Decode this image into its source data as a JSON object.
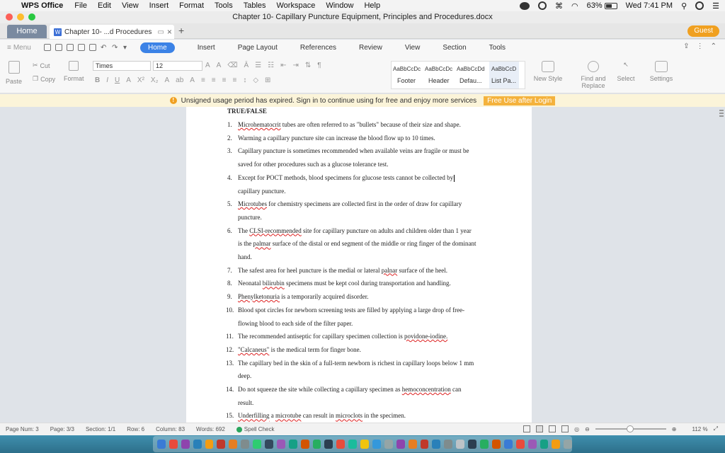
{
  "menubar": {
    "app_name": "WPS Office",
    "items": [
      "File",
      "Edit",
      "View",
      "Insert",
      "Format",
      "Tools",
      "Tables",
      "Workspace",
      "Window",
      "Help"
    ],
    "battery": "63%",
    "battery_level": 0.63,
    "clock": "Wed 7:41 PM"
  },
  "window": {
    "title": "Chapter 10- Capillary Puncture Equipment, Principles and Procedures.docx"
  },
  "tabs": {
    "home": "Home",
    "doc": "Chapter 10- ...d Procedures",
    "doc_close": "×",
    "new": "+",
    "guest": "Guest"
  },
  "ribbon_tabs": {
    "menu": "Menu",
    "items": [
      "Home",
      "Insert",
      "Page Layout",
      "References",
      "Review",
      "View",
      "Section",
      "Tools"
    ]
  },
  "ribbon": {
    "paste": "Paste",
    "cut": "Cut",
    "copy": "Copy",
    "format": "Format",
    "font_name": "Times",
    "font_size": "12",
    "styles_preview": [
      "AaBbCcDc",
      "AaBbCcDc",
      "AaBbCcDd",
      "AaBbCcD"
    ],
    "styles_names": [
      "Footer",
      "Header",
      "Defau...",
      "List Pa..."
    ],
    "new_style": "New Style",
    "find_replace": "Find and Replace",
    "select": "Select",
    "settings": "Settings"
  },
  "notice": {
    "text": "Unsigned usage period has expired. Sign in to continue using for free and enjoy more services",
    "button": "Free Use after Login"
  },
  "document": {
    "heading": "TRUE/FALSE",
    "lines": [
      {
        "num": "1.",
        "text": "Microhematocrit tubes are often referred to as \"bullets\" because of their size and shape."
      },
      {
        "num": "2.",
        "text": "Warming a capillary puncture site can increase the blood flow up to 10 times."
      },
      {
        "num": "3.",
        "text": "Capillary puncture is sometimes recommended when available veins are fragile or must be"
      },
      {
        "num": "",
        "text": "saved for other procedures such as a glucose tolerance test."
      },
      {
        "num": "4.",
        "text": "Except for POCT methods, blood specimens for glucose tests cannot be collected by"
      },
      {
        "num": "",
        "text": "capillary puncture."
      },
      {
        "num": "5.",
        "text": "Microtubes for chemistry specimens are collected first in the order of draw for capillary"
      },
      {
        "num": "",
        "text": "puncture."
      },
      {
        "num": "6.",
        "text": "The CLSI-recommended site for capillary puncture on adults and children older than 1 year"
      },
      {
        "num": "",
        "text": "is the palmar surface of the distal or end segment of the middle or ring finger of the dominant"
      },
      {
        "num": "",
        "text": "hand."
      },
      {
        "num": "7.",
        "text": "The safest area for heel puncture is the medial or lateral palnar surface of the heel."
      },
      {
        "num": "8.",
        "text": "Neonatal bilirubin specimens must be kept cool during transportation and handling."
      },
      {
        "num": "9.",
        "text": "Phenylketonuria is a temporarily acquired disorder."
      },
      {
        "num": "10.",
        "text": "Blood spot circles for newborn screening tests are filled by applying a large drop of free-"
      },
      {
        "num": "",
        "text": "flowing blood to each side of the filter paper."
      },
      {
        "num": "11.",
        "text": "The recommended antiseptic for capillary specimen collection is povidone-iodine."
      },
      {
        "num": "12.",
        "text": "\"Calcaneus\" is the medical term for finger bone."
      },
      {
        "num": "13.",
        "text": "The capillary bed in the skin of a full-term newborn is richest in capillary loops below 1 mm"
      },
      {
        "num": "",
        "text": "deep."
      },
      {
        "num": "14.",
        "text": "Do not squeeze the site while collecting a capillary specimen as hemoconcentration can"
      },
      {
        "num": "",
        "text": "result."
      },
      {
        "num": "15.",
        "text": "Underfilling a microtube can result in microclots in the specimen."
      }
    ]
  },
  "status": {
    "page_num": "Page Num: 3",
    "page": "Page: 3/3",
    "section": "Section: 1/1",
    "row": "Row: 6",
    "column": "Column: 83",
    "words": "Words: 692",
    "spell": "Spell Check",
    "zoom": "112 %"
  },
  "colors": {
    "accent": "#3b82e6",
    "guest": "#f0a020",
    "notice_bg": "#fbf4d9",
    "free_btn": "#f4b23c"
  }
}
